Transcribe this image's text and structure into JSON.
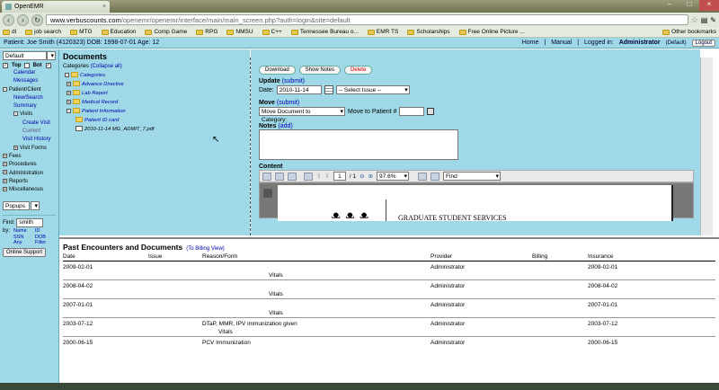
{
  "browser": {
    "tab_title": "OpenEMR",
    "url_domain": "www.verbuscounts.com",
    "url_path": "/openemr/openemr/interface/main/main_screen.php?auth=login&site=default",
    "bookmarks": [
      "dl",
      "job search",
      "MTG",
      "Education",
      "Comp Game",
      "RPG",
      "NMSU",
      "C++",
      "Tennessee Bureau o...",
      "EMR TS",
      "Scholarships",
      "Free Online Picture ..."
    ],
    "other_bookmarks": "Other bookmarks"
  },
  "header": {
    "patient": "Patient: Joe Smith (4120323)  DOB: 1998-07-01 Age: 12",
    "home": "Home",
    "manual": "Manual",
    "logged_in": "Logged in:",
    "user": "Administrator",
    "site": "(Default)",
    "logout": "Logout"
  },
  "leftnav": {
    "select_value": "Default",
    "top": "Top",
    "bot": "Bot",
    "items": [
      {
        "label": "Calendar",
        "level": 1,
        "link": true
      },
      {
        "label": "Messages",
        "level": 1,
        "link": true
      },
      {
        "label": "Patient/Client",
        "level": 0,
        "expand": "-"
      },
      {
        "label": "New/Search",
        "level": 1,
        "link": true
      },
      {
        "label": "Summary",
        "level": 1,
        "link": true
      },
      {
        "label": "Visits",
        "level": 1,
        "expand": "-"
      },
      {
        "label": "Create Visit",
        "level": 2,
        "link": true
      },
      {
        "label": "Current",
        "level": 2,
        "link": false
      },
      {
        "label": "Visit History",
        "level": 2,
        "link": true
      },
      {
        "label": "Visit Forms",
        "level": 1,
        "expand": "+"
      },
      {
        "label": "Fees",
        "level": 0,
        "expand": "+"
      },
      {
        "label": "Procedures",
        "level": 0,
        "expand": "+"
      },
      {
        "label": "Administration",
        "level": 0,
        "expand": "+"
      },
      {
        "label": "Reports",
        "level": 0,
        "expand": "+"
      },
      {
        "label": "Miscellaneous",
        "level": 0,
        "expand": "+"
      }
    ],
    "popups": "Popups",
    "find_label": "Find:",
    "find_value": "smith",
    "by_label": "by:",
    "by_options": [
      [
        "Name",
        "ID"
      ],
      [
        "SSN",
        "DOB"
      ],
      [
        "Any",
        "Filter"
      ]
    ],
    "online_support": "Online Support"
  },
  "documents": {
    "title": "Documents",
    "categories_label": "Categories",
    "collapse_all": "(Collapse all)",
    "tree": [
      {
        "label": "Categories",
        "level": 0,
        "icon": "folder"
      },
      {
        "label": "Advance Directive",
        "level": 1,
        "icon": "folder"
      },
      {
        "label": "Lab Report",
        "level": 1,
        "icon": "folder"
      },
      {
        "label": "Medical Record",
        "level": 1,
        "icon": "folder"
      },
      {
        "label": "Patient Information",
        "level": 1,
        "icon": "folder"
      },
      {
        "label": "Patient ID card",
        "level": 2,
        "icon": "folder"
      },
      {
        "label": "2010-11-14 MG_ADMIT_7.pdf",
        "level": 2,
        "icon": "file"
      }
    ]
  },
  "detail": {
    "buttons": {
      "download": "Download",
      "show_notes": "Show Notes",
      "delete": "Delete"
    },
    "update_label": "Update",
    "submit": "(submit)",
    "date_label": "Date:",
    "date_value": "2010-11-14",
    "issue_select": "-- Select Issue --",
    "move_label": "Move",
    "move_select": "Move Document to Category:",
    "move_to_patient": "Move to Patient #",
    "notes_label": "Notes",
    "notes_add": "(add)",
    "content_label": "Content",
    "pdf_page": "1",
    "pdf_pages": "/ 1",
    "pdf_zoom": "97.6%",
    "pdf_find": "Find",
    "pdf_text": "GRADUATE STUDENT SERVICES"
  },
  "encounters": {
    "title": "Past Encounters and Documents",
    "billing_link": "(To Billing View)",
    "columns": [
      "Date",
      "Issue",
      "Reason/Form",
      "Provider",
      "Billing",
      "Insurance"
    ],
    "rows": [
      {
        "date": "2009-02-01",
        "issue": "",
        "reason": "",
        "form": "Vitals",
        "provider": "Administrator",
        "billing": "",
        "insurance": "2009-02-01"
      },
      {
        "date": "2008-04-02",
        "issue": "",
        "reason": "",
        "form": "Vitals",
        "provider": "Administrator",
        "billing": "",
        "insurance": "2008-04-02"
      },
      {
        "date": "2007-01-01",
        "issue": "",
        "reason": "",
        "form": "Vitals",
        "provider": "Administrator",
        "billing": "",
        "insurance": "2007-01-01"
      },
      {
        "date": "2003-07-12",
        "issue": "",
        "reason": "DTaP, MMR, IPV immunization given",
        "form": "Vitals",
        "provider": "Administrator",
        "billing": "",
        "insurance": "2003-07-12"
      },
      {
        "date": "2000-06-15",
        "issue": "",
        "reason": "PCV Immunization",
        "form": "",
        "provider": "Administrator",
        "billing": "",
        "insurance": "2000-06-15"
      }
    ]
  },
  "colors": {
    "app_bg": "#9fd9e8",
    "link": "#0000aa"
  }
}
